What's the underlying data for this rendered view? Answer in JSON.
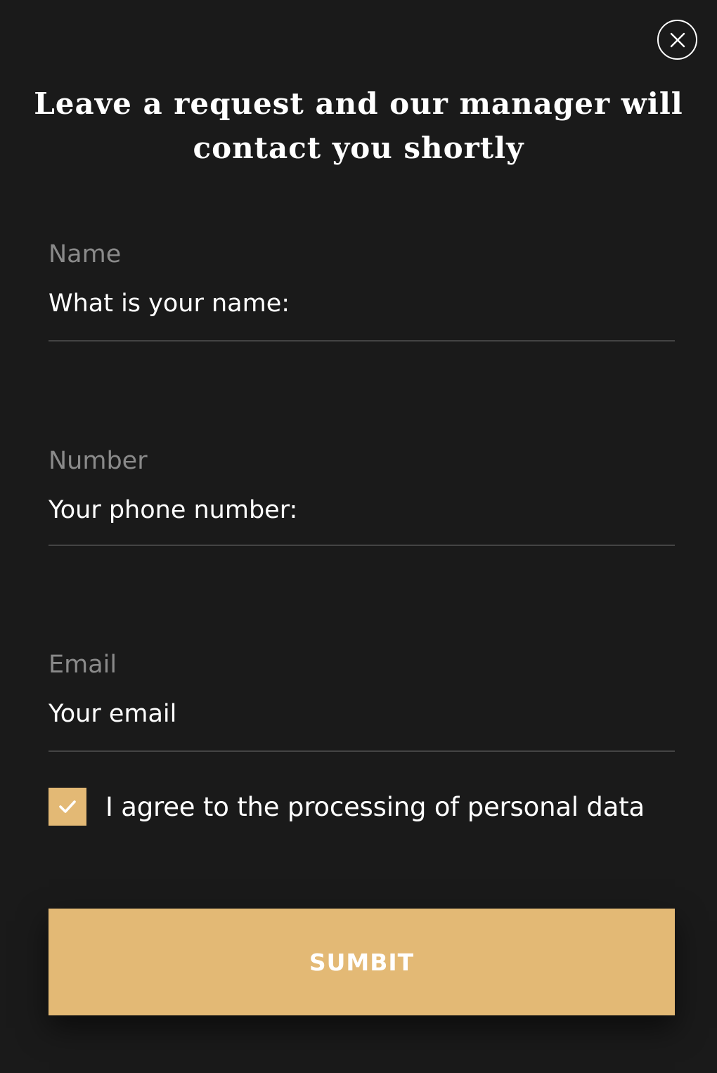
{
  "modal": {
    "title": "Leave a request and our manager will contact you shortly",
    "close_icon": "close-icon"
  },
  "form": {
    "name": {
      "label": "Name",
      "placeholder": "What is your name:",
      "value": ""
    },
    "number": {
      "label": "Number",
      "placeholder": "Your phone number:",
      "value": ""
    },
    "email": {
      "label": "Email",
      "placeholder": "Your email",
      "value": ""
    },
    "agree": {
      "label": "I agree to the processing of personal data",
      "checked": true,
      "icon": "checkmark-icon"
    },
    "submit_label": "SUMBIT"
  },
  "colors": {
    "background": "#1a1a1a",
    "accent": "#e3b975",
    "label": "#8a8a8a",
    "divider": "#444444",
    "text": "#ffffff"
  }
}
